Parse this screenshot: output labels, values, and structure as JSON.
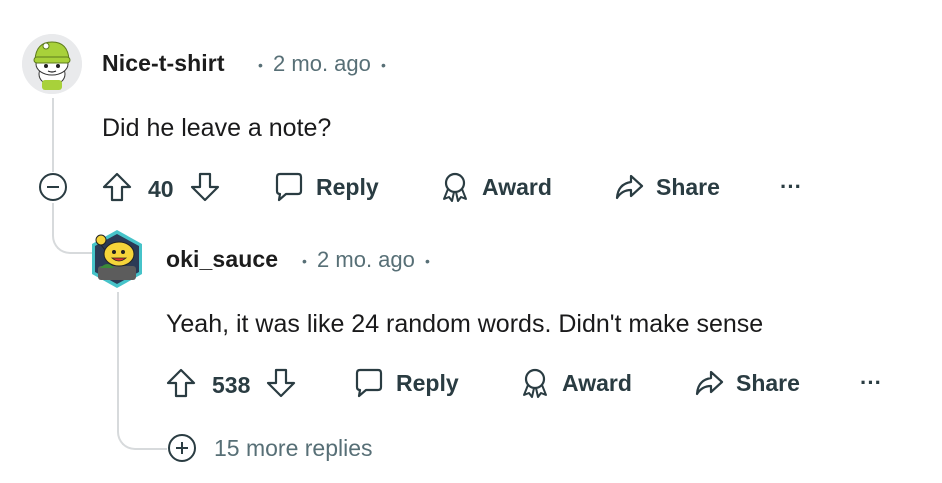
{
  "comment": {
    "username": "Nice-t-shirt",
    "time": "2 mo. ago",
    "body": "Did he leave a note?",
    "score": "40",
    "reply_label": "Reply",
    "award_label": "Award",
    "share_label": "Share",
    "more_label": "···"
  },
  "reply": {
    "username": "oki_sauce",
    "time": "2 mo. ago",
    "body": "Yeah, it was like 24 random words. Didn't make sense",
    "score": "538",
    "reply_label": "Reply",
    "award_label": "Award",
    "share_label": "Share",
    "more_label": "···"
  },
  "more_replies_label": "15 more replies",
  "separator": "•",
  "colors": {
    "avatar1_accent": "#a8d13a",
    "avatar2_accent": "#f5d43a",
    "avatar2_ring": "#46c3c9",
    "thread_line": "#d7dadc",
    "meta_text": "#576f76"
  }
}
